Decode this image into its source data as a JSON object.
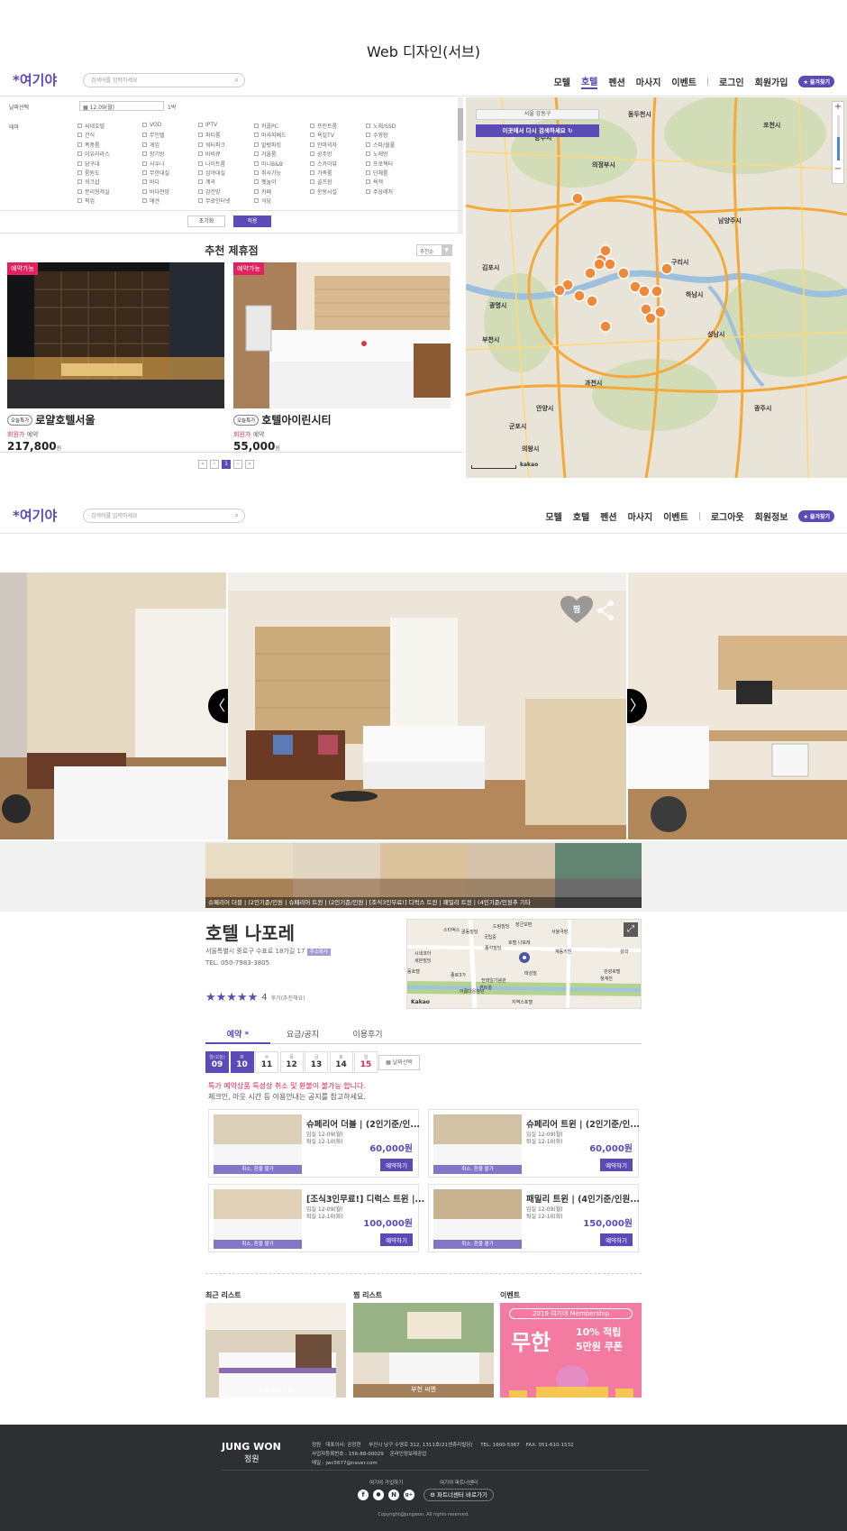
{
  "page_title": "Web 디자인(서브)",
  "top": {
    "logo": "여기야",
    "search_placeholder": "검색어를 입력하세요",
    "nav": [
      "모텔",
      "호텔",
      "펜션",
      "마사지",
      "이벤트"
    ],
    "active_nav": "호텔",
    "login": "로그인",
    "signup": "회원가입",
    "favorite": "즐겨찾기"
  },
  "filter": {
    "date_label": "날짜선택",
    "date_value": "12.09(월)",
    "nights": "1박",
    "theme_label": "테마",
    "themes": [
      [
        "씨네호텔",
        "VOD",
        "IPTV",
        "커플PC",
        "프린트룸",
        "노래/SSD"
      ],
      [
        "간식",
        "무인텔",
        "파티룸",
        "마사지베드",
        "욕실TV",
        "수영장"
      ],
      [
        "폭풍룸",
        "게임",
        "워터파크",
        "발렛파킹",
        "안마의자",
        "스파/월풀"
      ],
      [
        "이유라라스",
        "장기방",
        "바비큐",
        "거울룸",
        "공주방",
        "노래방"
      ],
      [
        "당구대",
        "사우나",
        "나이트룸",
        "미니B&B",
        "스카이뷰",
        "프로젝터"
      ],
      [
        "룸원도",
        "무한대실",
        "심야대실",
        "취사가능",
        "가족룸",
        "단체룸"
      ],
      [
        "워크샵",
        "바다",
        "계곡",
        "펫놀이",
        "골프장",
        "욕객"
      ],
      [
        "분리형객실",
        "바다전망",
        "강전망",
        "카페",
        "운동시설",
        "주상래처"
      ],
      [
        "픽업",
        "애견",
        "무료인터넷",
        "식당",
        "",
        ""
      ]
    ],
    "reset": "초기화",
    "apply": "적용"
  },
  "recommend": {
    "title": "추천 제휴점",
    "sort": "추천순",
    "cards": [
      {
        "badge": "예약가능",
        "tag": "오늘특가",
        "name": "로얄호텔서울",
        "sub": "회원가",
        "sub2": "예약",
        "price": "217,800",
        "unit": "원"
      },
      {
        "badge": "예약가능",
        "tag": "오늘특가",
        "name": "호텔아이린시티",
        "sub": "회원가",
        "sub2": "예약",
        "price": "55,000",
        "unit": "원"
      }
    ],
    "pages": [
      "«",
      "‹",
      "1",
      "›",
      "»"
    ]
  },
  "map": {
    "region": "서울 강동구",
    "search_here": "이곳에서 다시 검색하세요",
    "labels": [
      "동두천시",
      "양주시",
      "포천시",
      "의정부시",
      "남양주시",
      "구리시",
      "하남시",
      "성남시",
      "과천시",
      "안양시",
      "의왕시",
      "군포시",
      "광주시",
      "김포시",
      "부천시",
      "광명시"
    ]
  },
  "top2": {
    "logo": "여기야",
    "search_placeholder": "검색어를 입력하세요",
    "nav": [
      "모텔",
      "호텔",
      "펜션",
      "마사지",
      "이벤트"
    ],
    "logout": "로그아웃",
    "member": "회원정보",
    "favorite": "즐겨찾기"
  },
  "hero": {
    "like": "찜",
    "thumb_caption": "슈페리어 더블 | (2인기준/인원 | 슈페리어 트윈 | (2인기준/인원 | [조식3인무료!] 디럭스 트윈 | 패밀리 트윈 | (4인기준/인원추 기타"
  },
  "hotel": {
    "name": "호텔 나포레",
    "address": "서울특별시 중로구 수표로 18가길 17",
    "addr_badge": "주소복사",
    "tel": "TEL. 050-7983-3805",
    "rating_text": "4",
    "review_note": "후기(추천해요)",
    "map_labels": [
      "스타벅스",
      "골동빌딩",
      "국립중",
      "드림빌딩",
      "장군보편",
      "서울극장",
      "호텔 나포레",
      "종각빌딩",
      "시네코아",
      "세븐빌딩",
      "동호텔",
      "종로3가",
      "아름다운청년",
      "전태일기념관",
      "센트럴",
      "관광호텔",
      "청계천",
      "지역스포텔",
      "태성빌",
      "계동키친",
      "성곽"
    ]
  },
  "tabs": [
    "예약",
    "요금/공지",
    "이용후기"
  ],
  "dates": [
    {
      "wd": "월(오늘)",
      "d": "09",
      "sel": true
    },
    {
      "wd": "화",
      "d": "10",
      "sel": true
    },
    {
      "wd": "수",
      "d": "11",
      "sel": false
    },
    {
      "wd": "목",
      "d": "12",
      "sel": false
    },
    {
      "wd": "금",
      "d": "13",
      "sel": false
    },
    {
      "wd": "토",
      "d": "14",
      "sel": false
    },
    {
      "wd": "일",
      "d": "15",
      "sel": false
    }
  ],
  "date_select": "날짜선택",
  "notice": {
    "line1": "특가 예약상품 특성상 취소 및 환불이 불가능 합니다.",
    "line2": "체크인, 아웃 시간 등 이용안내는 공지를 참고하세요."
  },
  "rooms": [
    {
      "name": "슈페리어 더블 | (2인기준/인...",
      "in": "입실 12-09(월)",
      "out": "퇴실 12-10(화)",
      "price": "60,000원",
      "cancel": "취소, 환불 불가",
      "btn": "예약하기"
    },
    {
      "name": "슈페리어 트윈 | (2인기준/인...",
      "in": "입실 12-09(월)",
      "out": "퇴실 12-10(화)",
      "price": "60,000원",
      "cancel": "취소, 환불 불가",
      "btn": "예약하기"
    },
    {
      "name": "[조식3인무료!] 디럭스 트윈 |...",
      "in": "입실 12-09(월)",
      "out": "퇴실 12-10(화)",
      "price": "100,000원",
      "cancel": "취소, 환불 불가",
      "btn": "예약하기"
    },
    {
      "name": "패밀리 트윈 | (4인기준/인원...",
      "in": "입실 12-09(월)",
      "out": "퇴실 12-10(화)",
      "price": "150,000원",
      "cancel": "취소, 환불 불가",
      "btn": "예약하기"
    }
  ],
  "lists": {
    "recent_title": "최근 리스트",
    "recent_caption": "로얄호텔서울",
    "wish_title": "찜 리스트",
    "wish_caption": "부천 씨엔",
    "event_title": "이벤트",
    "event_top": "2019 여기야 Membership",
    "event_big": "무한",
    "event_l1": "10% 적립",
    "event_l2": "5만원 쿠폰"
  },
  "footer": {
    "brand": "JUNG WON",
    "brand_sub": "정원",
    "info1": "정원   대표이사: 공정현     부산시 남구 수영로 312, 1311호(21센츄리빌딩)     TEL: 1600-5367    FAX: 051-610-1532",
    "info2": "사업자등록번호 : 156-88-00029    온라인정보제공업",
    "info3": "메일 : jwc5677@naver.com",
    "join": "여기야 가입하기",
    "partner": "여기야 파트너센터",
    "partner_btn": "파트너센터 바로가기",
    "copyright": "Copyright@Jungwon.  All rights reserved.",
    "social": [
      "f",
      "talk",
      "N",
      "g+"
    ]
  },
  "colors": {
    "brand": "#5b4bb7",
    "accent": "#e4205e",
    "footer": "#2e2f33"
  }
}
